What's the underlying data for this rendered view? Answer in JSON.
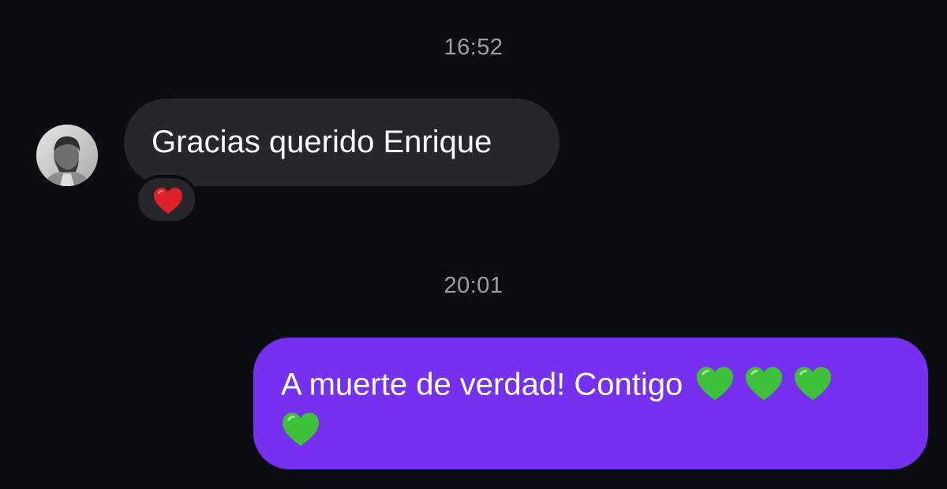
{
  "conversation": {
    "timestamps": [
      "16:52",
      "20:01"
    ],
    "incoming_message": {
      "text": "Gracias querido Enrique",
      "reaction": "red-heart"
    },
    "outgoing_message": {
      "text": "A muerte de verdad! Contigo",
      "emoji": [
        "green-heart",
        "green-heart",
        "green-heart",
        "green-heart"
      ]
    }
  },
  "colors": {
    "background": "#0b0d11",
    "incoming_bubble": "#26272b",
    "outgoing_bubble": "#7631f0",
    "timestamp": "#9c9fa6",
    "red_heart": "#e0202b",
    "green_heart": "#3fc03a"
  }
}
